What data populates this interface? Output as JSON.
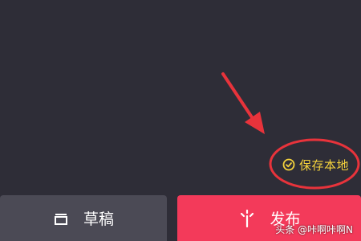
{
  "colors": {
    "background": "#2e2d37",
    "save_text": "#f4d23c",
    "annotation_red": "#e8333b",
    "draft_bg": "#4b4a55",
    "publish_bg": "#f33a5a"
  },
  "status": {
    "save_local_label": "保存本地",
    "save_icon": "check-circle-icon"
  },
  "bottom_bar": {
    "draft_label": "草稿",
    "draft_icon": "draft-box-icon",
    "publish_label": "发布",
    "publish_icon": "sparkle-icon"
  },
  "watermark": {
    "text": "头条 @咔啊咔啊N"
  }
}
